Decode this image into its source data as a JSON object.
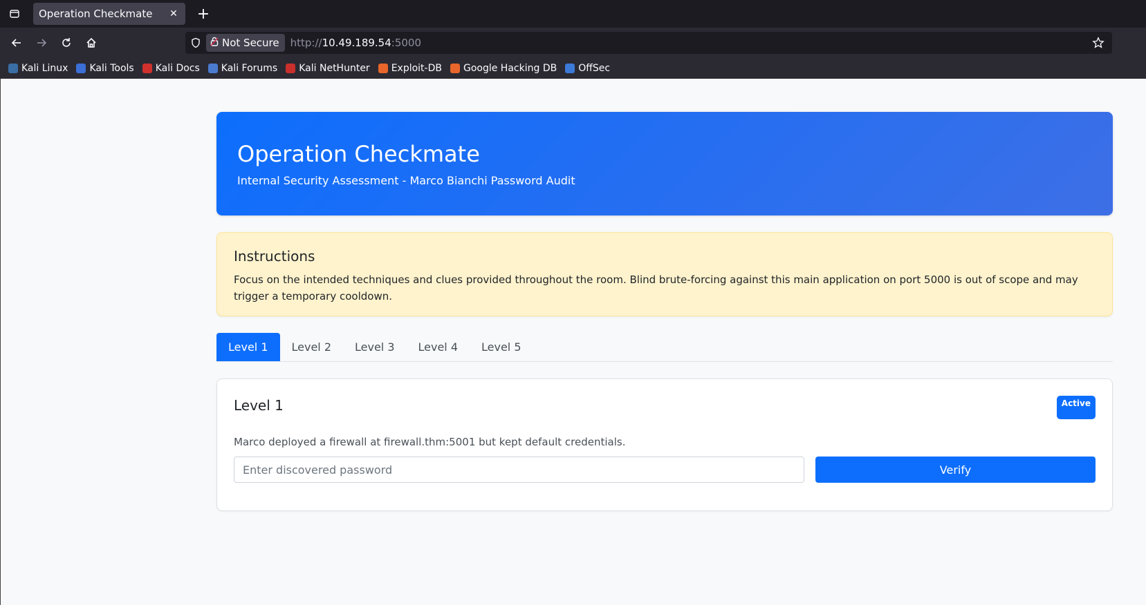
{
  "browser": {
    "tab_title": "Operation Checkmate",
    "tab_close": "✕",
    "new_tab": "+",
    "security_label": "Not Secure",
    "url_scheme": "http://",
    "url_host": "10.49.189.54",
    "url_port": ":5000",
    "bookmarks": [
      {
        "label": "Kali Linux",
        "color": "#3a6ea5"
      },
      {
        "label": "Kali Tools",
        "color": "#3b6fd6"
      },
      {
        "label": "Kali Docs",
        "color": "#d0312d"
      },
      {
        "label": "Kali Forums",
        "color": "#4a7bd1"
      },
      {
        "label": "Kali NetHunter",
        "color": "#c9302c"
      },
      {
        "label": "Exploit-DB",
        "color": "#e8662b"
      },
      {
        "label": "Google Hacking DB",
        "color": "#e8662b"
      },
      {
        "label": "OffSec",
        "color": "#3c7ad8"
      }
    ]
  },
  "hero": {
    "title": "Operation Checkmate",
    "subtitle": "Internal Security Assessment - Marco Bianchi Password Audit"
  },
  "instructions": {
    "title": "Instructions",
    "text": "Focus on the intended techniques and clues provided throughout the room. Blind brute-forcing against this main application on port 5000 is out of scope and may trigger a temporary cooldown."
  },
  "levels": {
    "tabs": [
      "Level 1",
      "Level 2",
      "Level 3",
      "Level 4",
      "Level 5"
    ],
    "active_index": 0
  },
  "card": {
    "title": "Level 1",
    "badge": "Active",
    "description": "Marco deployed a firewall at firewall.thm:5001 but kept default credentials.",
    "input_placeholder": "Enter discovered password",
    "button_label": "Verify"
  }
}
